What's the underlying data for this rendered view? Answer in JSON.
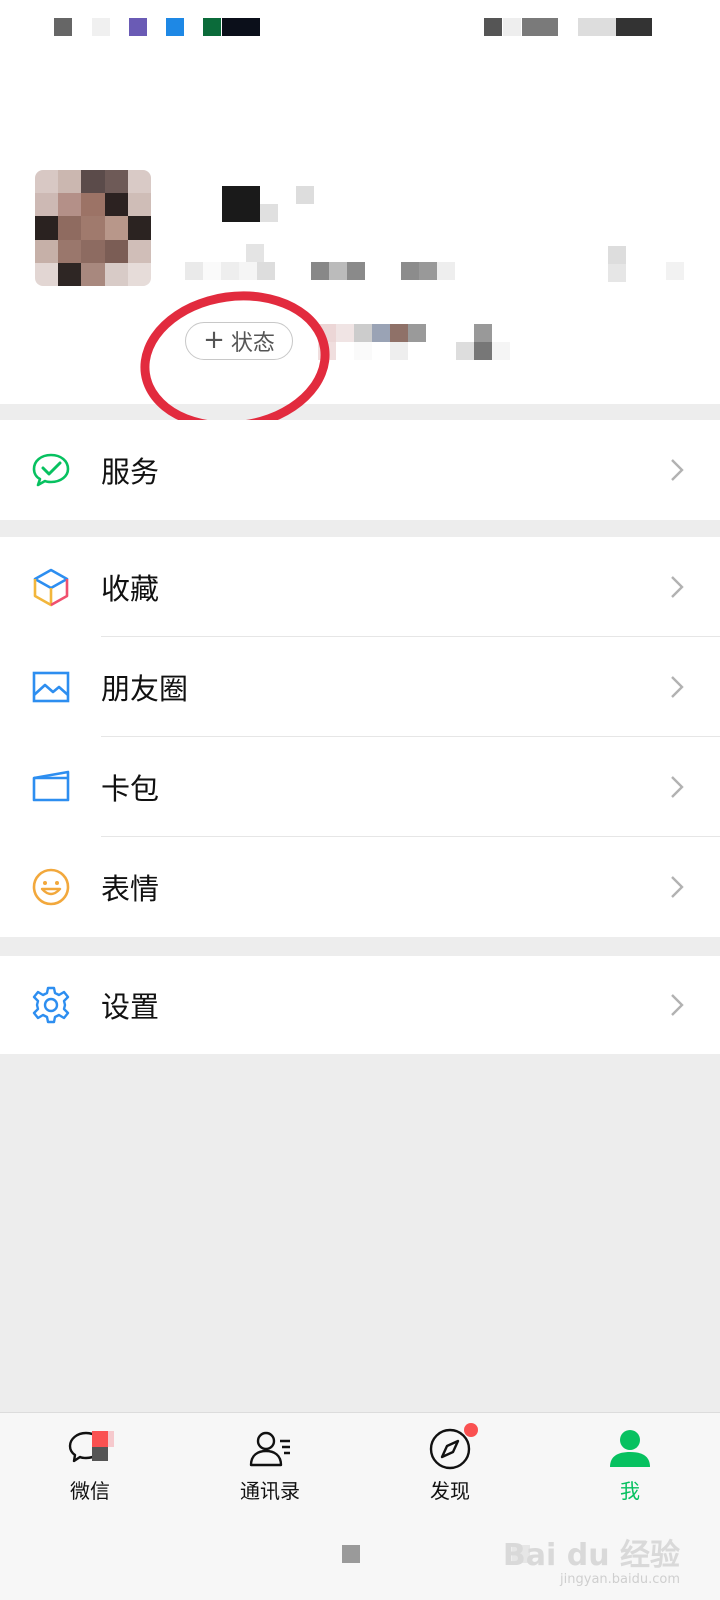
{
  "profile": {
    "status_button": {
      "plus": "+",
      "label": "状态"
    }
  },
  "menu": {
    "services": {
      "label": "服务",
      "icon": "wechat-pay-icon"
    },
    "items": [
      {
        "label": "收藏",
        "icon": "favorites-cube-icon"
      },
      {
        "label": "朋友圈",
        "icon": "moments-image-icon"
      },
      {
        "label": "卡包",
        "icon": "card-wallet-icon"
      },
      {
        "label": "表情",
        "icon": "smiley-face-icon"
      }
    ],
    "settings": {
      "label": "设置",
      "icon": "gear-icon"
    }
  },
  "tabbar": {
    "tabs": [
      {
        "label": "微信",
        "icon": "chat-bubbles-icon",
        "active": false
      },
      {
        "label": "通讯录",
        "icon": "contacts-icon",
        "active": false
      },
      {
        "label": "发现",
        "icon": "compass-icon",
        "active": false,
        "badge": true
      },
      {
        "label": "我",
        "icon": "person-icon",
        "active": true
      }
    ]
  },
  "watermark": {
    "text": "Bai du 经验",
    "sub": "jingyan.baidu.com"
  },
  "colors": {
    "accent_green": "#07c160",
    "highlight_circle": "#e22b3e",
    "badge_red": "#fa5151",
    "background": "#ededed"
  }
}
